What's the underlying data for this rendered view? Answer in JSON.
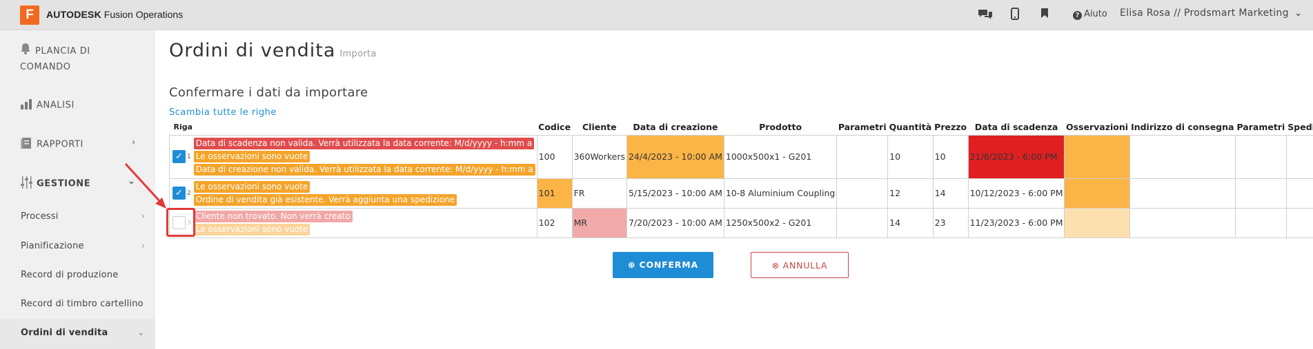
{
  "topbar": {
    "logo_letter": "F",
    "brand_bold": "AUTODESK",
    "brand_rest": "Fusion Operations",
    "help_label": "Aiuto",
    "user_label": "Elisa Rosa // Prodsmart Marketing"
  },
  "sidebar": {
    "dashboard_line1": "PLANCIA DI",
    "dashboard_line2": "COMANDO",
    "analysis": "ANALISI",
    "reports": "RAPPORTI",
    "management": "GESTIONE",
    "sub_items": [
      "Processi",
      "Pianificazione",
      "Record di produzione",
      "Record di timbro cartellino",
      "Ordini di vendita"
    ]
  },
  "page": {
    "title": "Ordini di vendita",
    "title_tag": "Importa",
    "subtitle": "Confermare i dati da importare",
    "swap_link": "Scambia tutte le righe"
  },
  "table": {
    "headers": [
      "Riga",
      "Codice",
      "Cliente",
      "Data di creazione",
      "Prodotto",
      "Parametri",
      "Quantità",
      "Prezzo",
      "Data di scadenza",
      "Osservazioni",
      "Indirizzo di consegna",
      "Parametri",
      "Spedizione"
    ],
    "rows": [
      {
        "num": "1",
        "checked": true,
        "messages": [
          {
            "type": "err",
            "text": "Data di scadenza non valida. Verrà utilizzata la data corrente: M/d/yyyy - h:mm a"
          },
          {
            "type": "warn",
            "text": "Le osservazioni sono vuote"
          },
          {
            "type": "warn",
            "text": "Data di creazione non valida. Verrà utilizzata la data corrente: M/d/yyyy - h:mm a"
          }
        ],
        "codice": "100",
        "cliente": "360Workers",
        "data_creazione": "24/4/2023 - 10:00 AM",
        "prodotto": "1000x500x1 - G201",
        "parametri": "",
        "quantita": "10",
        "prezzo": "10",
        "data_scadenza": "21/8/2023 - 6:00 PM",
        "osservazioni": "",
        "indirizzo": "",
        "parametri2": "",
        "spedizione": ""
      },
      {
        "num": "2",
        "checked": true,
        "messages": [
          {
            "type": "warn",
            "text": "Le osservazioni sono vuote"
          },
          {
            "type": "warn",
            "text": "Ordine di vendita già esistente. Verrà aggiunta una spedizione"
          }
        ],
        "codice": "101",
        "cliente": "FR",
        "data_creazione": "5/15/2023 - 10:00 AM",
        "prodotto": "10-8 Aluminium Coupling",
        "parametri": "",
        "quantita": "12",
        "prezzo": "14",
        "data_scadenza": "10/12/2023 - 6:00 PM",
        "osservazioni": "",
        "indirizzo": "",
        "parametri2": "",
        "spedizione": ""
      },
      {
        "num": "3",
        "checked": false,
        "messages": [
          {
            "type": "err",
            "text": "Cliente non trovato. Non verrà creato"
          },
          {
            "type": "warn",
            "text": "Le osservazioni sono vuote"
          }
        ],
        "codice": "102",
        "cliente": "MR",
        "data_creazione": "7/20/2023 - 10:00 AM",
        "prodotto": "1250x500x2 - G201",
        "parametri": "",
        "quantita": "14",
        "prezzo": "23",
        "data_scadenza": "11/23/2023 - 6:00 PM",
        "osservazioni": "",
        "indirizzo": "",
        "parametri2": "",
        "spedizione": ""
      }
    ]
  },
  "buttons": {
    "confirm": "CONFERMA",
    "cancel": "ANNULLA"
  },
  "colors": {
    "accent_blue": "#1f8dd6",
    "error_red": "#e04d4d",
    "warning_orange": "#f5a42a",
    "highlight_red": "#e23a3a"
  }
}
